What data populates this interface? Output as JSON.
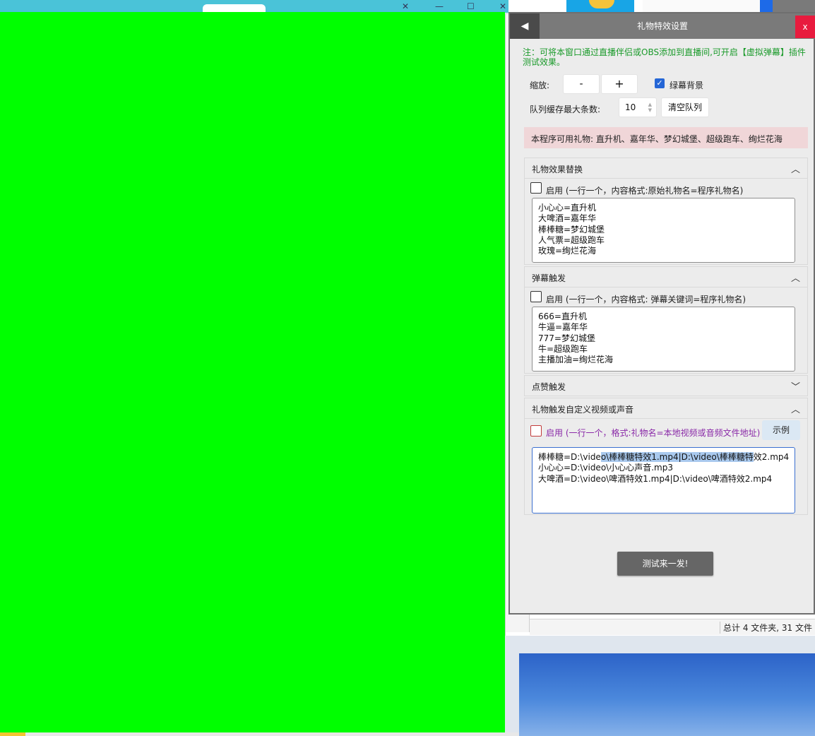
{
  "dialog": {
    "title": "礼物特效设置",
    "back_icon": "◀",
    "close_label": "x",
    "note": "注：可将本窗口通过直播伴侣或OBS添加到直播间,可开启【虚拟弹幕】插件测试效果。",
    "zoom_label": "缩放:",
    "zoom_minus": "-",
    "zoom_plus": "+",
    "green_bg_label": "绿幕背景",
    "green_bg_checked": true,
    "queue_label": "队列缓存最大条数:",
    "queue_value": "10",
    "clear_queue": "清空队列",
    "available_gifts": "本程序可用礼物:  直升机、嘉年华、梦幻城堡、超级跑车、绚烂花海",
    "sections": {
      "gift_replace": {
        "title": "礼物效果替换",
        "expanded": true,
        "enable_label": "启用 (一行一个，内容格式:原始礼物名=程序礼物名)",
        "lines": [
          "小心心=直升机",
          "大啤酒=嘉年华",
          "棒棒糖=梦幻城堡",
          "人气票=超级跑车",
          "玫瑰=绚烂花海"
        ]
      },
      "danmu_trigger": {
        "title": "弹幕触发",
        "expanded": true,
        "enable_label": "启用 (一行一个，内容格式: 弹幕关键词=程序礼物名)",
        "lines": [
          "666=直升机",
          "牛逼=嘉年华",
          "777=梦幻城堡",
          "牛=超级跑车",
          "主播加油=绚烂花海"
        ]
      },
      "like_trigger": {
        "title": "点赞触发",
        "expanded": false
      },
      "custom_media": {
        "title": "礼物触发自定义视频或声音",
        "expanded": true,
        "enable_label": "启用 (一行一个，格式:礼物名=本地视频或音频文件地址)",
        "example_button": "示例",
        "line1_pre": "棒棒糖=D:\\vide",
        "line1_sel": "o\\棒棒糖特效1.mp4|D:\\video\\棒棒糖特",
        "line1_post": "效2.mp4",
        "line2": "小心心=D:\\video\\小心心声音.mp3",
        "line3": "大啤酒=D:\\video\\啤酒特效1.mp4|D:\\video\\啤酒特效2.mp4"
      }
    },
    "test_button": "测试来一发!"
  },
  "background": {
    "status_text": "总计 4 文件夹, 31 文件",
    "green_color": "#00ff00"
  }
}
